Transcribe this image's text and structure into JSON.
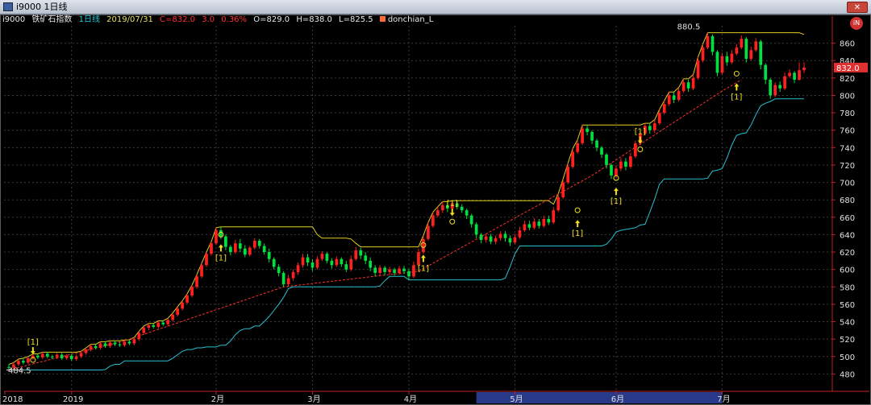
{
  "window": {
    "title": "i9000 1日线",
    "close_label": "✕"
  },
  "info_bar": {
    "symbol": "i9000",
    "name": "铁矿石指数",
    "period": "1日线",
    "date": "2019/07/31",
    "close": "C=832.0",
    "change": "3.0",
    "change_pct": "0.36%",
    "open": "O=829.0",
    "high": "H=838.0",
    "low": "L=825.5",
    "indicator": "donchian_L",
    "indicator_button": "iN"
  },
  "colors": {
    "up": "#ff2020",
    "down": "#00e040",
    "upper_band": "#e0d020",
    "lower_band": "#28c0d0",
    "trend": "#ff3030",
    "grid": "#3a3a3a",
    "axis_text": "#e0e0e0",
    "price_tag": "#e03030",
    "time_highlight": "#2a3a8a"
  },
  "chart_data": {
    "type": "candlestick",
    "y_range": [
      460,
      880
    ],
    "y_ticks": [
      480,
      500,
      520,
      540,
      560,
      580,
      600,
      620,
      640,
      660,
      680,
      700,
      720,
      740,
      760,
      780,
      800,
      820,
      840,
      860
    ],
    "x_labels": [
      "2018",
      "2019",
      "2月",
      "3月",
      "4月",
      "5月",
      "6月",
      "7月"
    ],
    "current_price": "832.0",
    "annotations": [
      "484.5",
      "880.5"
    ],
    "signal_label": "[1]",
    "candles": [
      [
        488,
        487,
        491,
        484.5
      ],
      [
        487,
        491,
        493,
        485
      ],
      [
        491,
        495,
        497,
        489
      ],
      [
        495,
        493,
        498,
        491
      ],
      [
        493,
        498,
        500,
        491
      ],
      [
        498,
        501,
        503,
        496
      ],
      [
        501,
        499,
        503,
        497
      ],
      [
        499,
        503,
        505,
        497
      ],
      [
        503,
        500,
        505,
        498
      ],
      [
        500,
        499,
        502,
        497
      ],
      [
        499,
        502,
        504,
        497
      ],
      [
        502,
        498,
        504,
        496
      ],
      [
        498,
        501,
        503,
        496
      ],
      [
        501,
        497,
        503,
        495
      ],
      [
        497,
        500,
        502,
        495
      ],
      [
        500,
        504,
        506,
        498
      ],
      [
        504,
        508,
        510,
        502
      ],
      [
        508,
        512,
        514,
        506
      ],
      [
        512,
        510,
        514,
        508
      ],
      [
        510,
        515,
        517,
        508
      ],
      [
        515,
        512,
        517,
        510
      ],
      [
        512,
        516,
        518,
        510
      ],
      [
        516,
        514,
        518,
        512
      ],
      [
        514,
        513,
        516,
        511
      ],
      [
        513,
        517,
        519,
        511
      ],
      [
        517,
        515,
        519,
        513
      ],
      [
        515,
        520,
        522,
        513
      ],
      [
        520,
        527,
        529,
        518
      ],
      [
        527,
        533,
        535,
        525
      ],
      [
        533,
        536,
        538,
        530
      ],
      [
        536,
        534,
        538,
        532
      ],
      [
        534,
        539,
        541,
        532
      ],
      [
        539,
        537,
        541,
        535
      ],
      [
        537,
        542,
        544,
        535
      ],
      [
        542,
        548,
        550,
        540
      ],
      [
        548,
        555,
        557,
        546
      ],
      [
        555,
        562,
        564,
        553
      ],
      [
        562,
        570,
        572,
        560
      ],
      [
        570,
        580,
        582,
        568
      ],
      [
        580,
        592,
        594,
        578
      ],
      [
        592,
        605,
        607,
        590
      ],
      [
        605,
        618,
        620,
        603
      ],
      [
        618,
        630,
        632,
        616
      ],
      [
        630,
        645,
        648,
        628
      ],
      [
        645,
        638,
        649,
        635
      ],
      [
        638,
        626,
        640,
        622
      ],
      [
        626,
        620,
        628,
        616
      ],
      [
        620,
        630,
        634,
        618
      ],
      [
        630,
        624,
        635,
        620
      ],
      [
        624,
        617,
        628,
        614
      ],
      [
        617,
        625,
        627,
        615
      ],
      [
        625,
        633,
        636,
        623
      ],
      [
        633,
        627,
        635,
        624
      ],
      [
        627,
        620,
        630,
        617
      ],
      [
        620,
        612,
        624,
        608
      ],
      [
        612,
        603,
        614,
        600
      ],
      [
        603,
        596,
        606,
        592
      ],
      [
        596,
        583,
        598,
        580
      ],
      [
        583,
        590,
        594,
        581
      ],
      [
        590,
        597,
        600,
        587
      ],
      [
        597,
        605,
        608,
        594
      ],
      [
        605,
        614,
        618,
        602
      ],
      [
        614,
        608,
        618,
        604
      ],
      [
        608,
        602,
        612,
        598
      ],
      [
        602,
        612,
        615,
        600
      ],
      [
        612,
        618,
        621,
        610
      ],
      [
        618,
        610,
        620,
        607
      ],
      [
        610,
        605,
        613,
        601
      ],
      [
        605,
        612,
        615,
        603
      ],
      [
        612,
        606,
        614,
        603
      ],
      [
        606,
        600,
        610,
        597
      ],
      [
        600,
        612,
        616,
        598
      ],
      [
        612,
        622,
        626,
        610
      ],
      [
        622,
        616,
        625,
        612
      ],
      [
        616,
        610,
        620,
        606
      ],
      [
        610,
        602,
        614,
        598
      ],
      [
        602,
        596,
        605,
        592
      ],
      [
        596,
        602,
        605,
        593
      ],
      [
        602,
        597,
        604,
        593
      ],
      [
        597,
        600,
        603,
        594
      ],
      [
        600,
        596,
        602,
        593
      ],
      [
        596,
        601,
        604,
        594
      ],
      [
        601,
        598,
        604,
        595
      ],
      [
        598,
        592,
        601,
        588
      ],
      [
        592,
        605,
        609,
        590
      ],
      [
        605,
        620,
        624,
        603
      ],
      [
        620,
        635,
        639,
        618
      ],
      [
        635,
        650,
        654,
        633
      ],
      [
        650,
        662,
        666,
        648
      ],
      [
        662,
        668,
        672,
        660
      ],
      [
        668,
        674,
        678,
        665
      ],
      [
        674,
        670,
        677,
        666
      ],
      [
        670,
        676,
        679,
        668
      ],
      [
        676,
        672,
        679,
        669
      ],
      [
        672,
        668,
        675,
        665
      ],
      [
        668,
        662,
        670,
        658
      ],
      [
        662,
        652,
        664,
        648
      ],
      [
        652,
        640,
        654,
        636
      ],
      [
        640,
        634,
        642,
        630
      ],
      [
        634,
        638,
        641,
        631
      ],
      [
        638,
        632,
        641,
        629
      ],
      [
        632,
        636,
        639,
        629
      ],
      [
        636,
        641,
        644,
        633
      ],
      [
        641,
        636,
        644,
        632
      ],
      [
        636,
        631,
        639,
        627
      ],
      [
        631,
        637,
        641,
        629
      ],
      [
        637,
        645,
        649,
        635
      ],
      [
        645,
        652,
        656,
        643
      ],
      [
        652,
        648,
        656,
        645
      ],
      [
        648,
        655,
        659,
        646
      ],
      [
        655,
        650,
        658,
        647
      ],
      [
        650,
        658,
        662,
        648
      ],
      [
        658,
        654,
        662,
        651
      ],
      [
        654,
        668,
        672,
        652
      ],
      [
        668,
        683,
        687,
        666
      ],
      [
        683,
        700,
        704,
        681
      ],
      [
        700,
        718,
        722,
        698
      ],
      [
        718,
        735,
        739,
        716
      ],
      [
        735,
        745,
        749,
        733
      ],
      [
        745,
        762,
        766,
        743
      ],
      [
        762,
        758,
        766,
        754
      ],
      [
        758,
        748,
        760,
        744
      ],
      [
        748,
        740,
        750,
        736
      ],
      [
        740,
        732,
        742,
        728
      ],
      [
        732,
        720,
        734,
        716
      ],
      [
        720,
        708,
        722,
        704
      ],
      [
        708,
        716,
        720,
        705
      ],
      [
        716,
        724,
        728,
        713
      ],
      [
        724,
        718,
        728,
        714
      ],
      [
        718,
        730,
        734,
        716
      ],
      [
        730,
        745,
        748,
        728
      ],
      [
        745,
        756,
        760,
        743
      ],
      [
        756,
        765,
        768,
        754
      ],
      [
        765,
        760,
        768,
        756
      ],
      [
        760,
        768,
        772,
        757
      ],
      [
        768,
        780,
        784,
        766
      ],
      [
        780,
        790,
        794,
        778
      ],
      [
        790,
        800,
        804,
        788
      ],
      [
        800,
        795,
        804,
        791
      ],
      [
        795,
        805,
        809,
        793
      ],
      [
        805,
        815,
        819,
        803
      ],
      [
        815,
        808,
        818,
        804
      ],
      [
        808,
        820,
        824,
        806
      ],
      [
        820,
        840,
        844,
        818
      ],
      [
        840,
        855,
        859,
        838
      ],
      [
        855,
        868,
        872,
        853
      ],
      [
        868,
        850,
        870,
        846
      ],
      [
        850,
        826,
        852,
        822
      ],
      [
        826,
        845,
        849,
        824
      ],
      [
        845,
        838,
        850,
        834
      ],
      [
        838,
        848,
        852,
        836
      ],
      [
        848,
        855,
        859,
        846
      ],
      [
        855,
        865,
        869,
        853
      ],
      [
        865,
        842,
        867,
        838
      ],
      [
        842,
        852,
        856,
        840
      ],
      [
        852,
        862,
        866,
        850
      ],
      [
        862,
        835,
        864,
        830
      ],
      [
        835,
        818,
        837,
        813
      ],
      [
        818,
        800,
        820,
        796
      ],
      [
        800,
        812,
        815,
        798
      ],
      [
        812,
        808,
        816,
        804
      ],
      [
        808,
        822,
        826,
        806
      ],
      [
        822,
        826,
        830,
        820
      ],
      [
        826,
        818,
        828,
        814
      ],
      [
        818,
        829,
        838,
        817
      ],
      [
        829,
        832,
        838,
        825.5
      ]
    ]
  }
}
